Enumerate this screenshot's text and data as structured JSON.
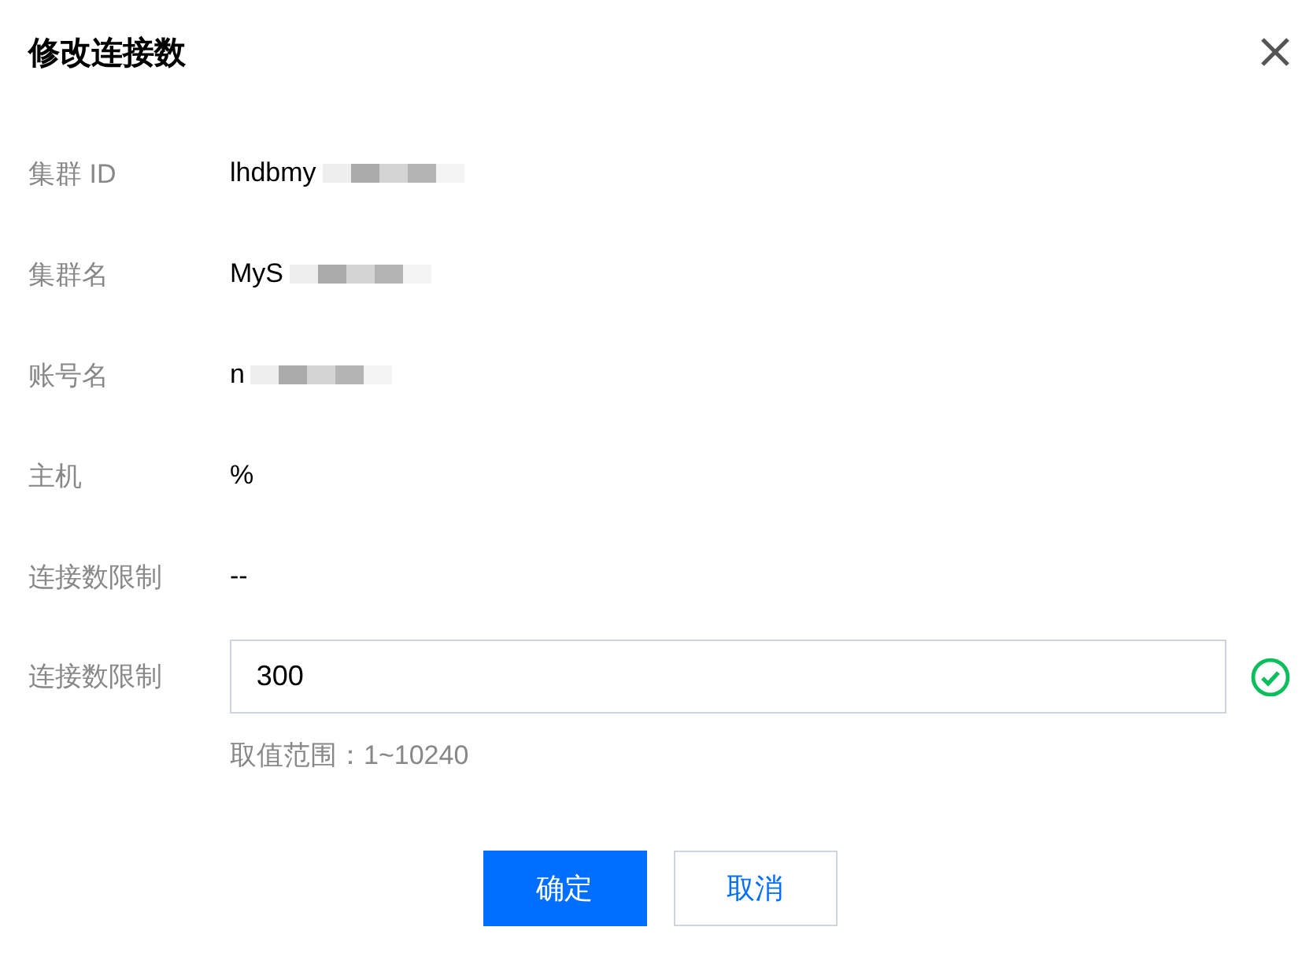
{
  "dialog": {
    "title": "修改连接数"
  },
  "fields": [
    {
      "label": "集群 ID",
      "value": "lhdbmy",
      "redacted": true
    },
    {
      "label": "集群名",
      "value": "MyS",
      "redacted": true
    },
    {
      "label": "账号名",
      "value": "n",
      "redacted": true
    },
    {
      "label": "主机",
      "value": "%",
      "redacted": false
    },
    {
      "label": "连接数限制",
      "value": "--",
      "redacted": false
    }
  ],
  "input": {
    "label": "连接数限制",
    "value": "300",
    "valid": true,
    "hint": "取值范围：1~10240"
  },
  "buttons": [
    {
      "label": "确定",
      "kind": "primary"
    },
    {
      "label": "取消",
      "kind": "secondary"
    }
  ]
}
